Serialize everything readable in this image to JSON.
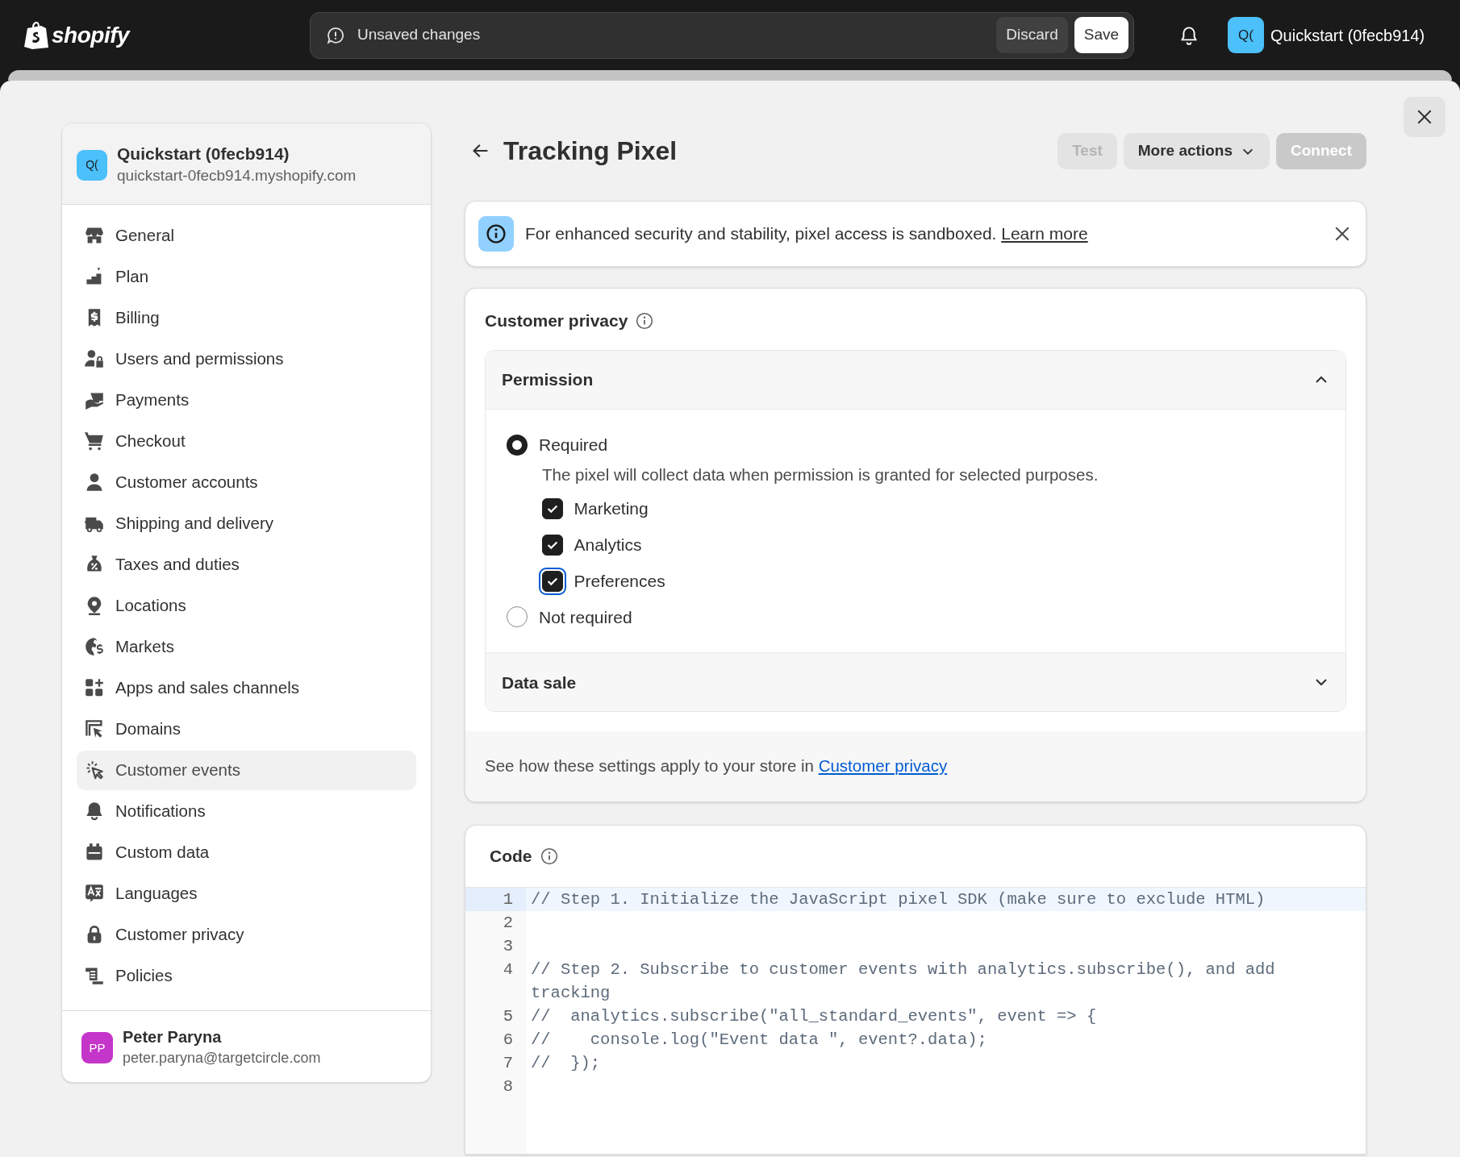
{
  "top_bar": {
    "logo": "shopify",
    "save_bar": {
      "message": "Unsaved changes",
      "buttons": [
        {
          "label": "Discard",
          "kind": "secondary"
        },
        {
          "label": "Save",
          "kind": "primary"
        }
      ]
    },
    "store": {
      "avatar": "Q(",
      "name": "Quickstart (0fecb914)"
    }
  },
  "sidebar": {
    "store": {
      "avatar": "Q(",
      "name": "Quickstart (0fecb914)",
      "domain": "quickstart-0fecb914.myshopify.com"
    },
    "items": [
      {
        "label": "General",
        "selected": false
      },
      {
        "label": "Plan",
        "selected": false
      },
      {
        "label": "Billing",
        "selected": false
      },
      {
        "label": "Users and permissions",
        "selected": false
      },
      {
        "label": "Payments",
        "selected": false
      },
      {
        "label": "Checkout",
        "selected": false
      },
      {
        "label": "Customer accounts",
        "selected": false
      },
      {
        "label": "Shipping and delivery",
        "selected": false
      },
      {
        "label": "Taxes and duties",
        "selected": false
      },
      {
        "label": "Locations",
        "selected": false
      },
      {
        "label": "Markets",
        "selected": false
      },
      {
        "label": "Apps and sales channels",
        "selected": false
      },
      {
        "label": "Domains",
        "selected": false
      },
      {
        "label": "Customer events",
        "selected": true
      },
      {
        "label": "Notifications",
        "selected": false
      },
      {
        "label": "Custom data",
        "selected": false
      },
      {
        "label": "Languages",
        "selected": false
      },
      {
        "label": "Customer privacy",
        "selected": false
      },
      {
        "label": "Policies",
        "selected": false
      }
    ],
    "user": {
      "avatar": "PP",
      "name": "Peter Paryna",
      "email": "peter.paryna@targetcircle.com"
    }
  },
  "page": {
    "title": "Tracking Pixel",
    "actions": [
      {
        "label": "Test",
        "kind": "secondary",
        "disabled": true
      },
      {
        "label": "More actions",
        "kind": "menu",
        "disabled": false
      },
      {
        "label": "Connect",
        "kind": "primary",
        "disabled": true
      }
    ]
  },
  "banner": {
    "text": "For enhanced security and stability, pixel access is sandboxed.",
    "link": "Learn more"
  },
  "customer_privacy": {
    "title": "Customer privacy",
    "sections": [
      {
        "title": "Permission",
        "expanded": true,
        "options": [
          {
            "label": "Required",
            "selected": true,
            "description": "The pixel will collect data when permission is granted for selected purposes.",
            "purposes": [
              {
                "label": "Marketing",
                "checked": true,
                "focused": false
              },
              {
                "label": "Analytics",
                "checked": true,
                "focused": false
              },
              {
                "label": "Preferences",
                "checked": true,
                "focused": true
              }
            ]
          },
          {
            "label": "Not required",
            "selected": false
          }
        ]
      },
      {
        "title": "Data sale",
        "expanded": false
      }
    ],
    "footer": {
      "text": "See how these settings apply to your store in",
      "link": "Customer privacy"
    }
  },
  "code": {
    "title": "Code",
    "lines": [
      {
        "number": "1",
        "text": "// Step 1. Initialize the JavaScript pixel SDK (make sure to exclude HTML)",
        "selected": true
      },
      {
        "number": "2",
        "selected": false
      },
      {
        "number": "3",
        "selected": false
      },
      {
        "number": "4",
        "text": "// Step 2. Subscribe to customer events with analytics.subscribe(), and add tracking",
        "selected": false
      },
      {
        "number": "5",
        "text": "//  analytics.subscribe(\"all_standard_events\", event => {",
        "selected": false
      },
      {
        "number": "6",
        "text": "//    console.log(\"Event data \", event?.data);",
        "selected": false
      },
      {
        "number": "7",
        "text": "//  });",
        "selected": false
      },
      {
        "number": "8",
        "selected": false
      }
    ]
  }
}
